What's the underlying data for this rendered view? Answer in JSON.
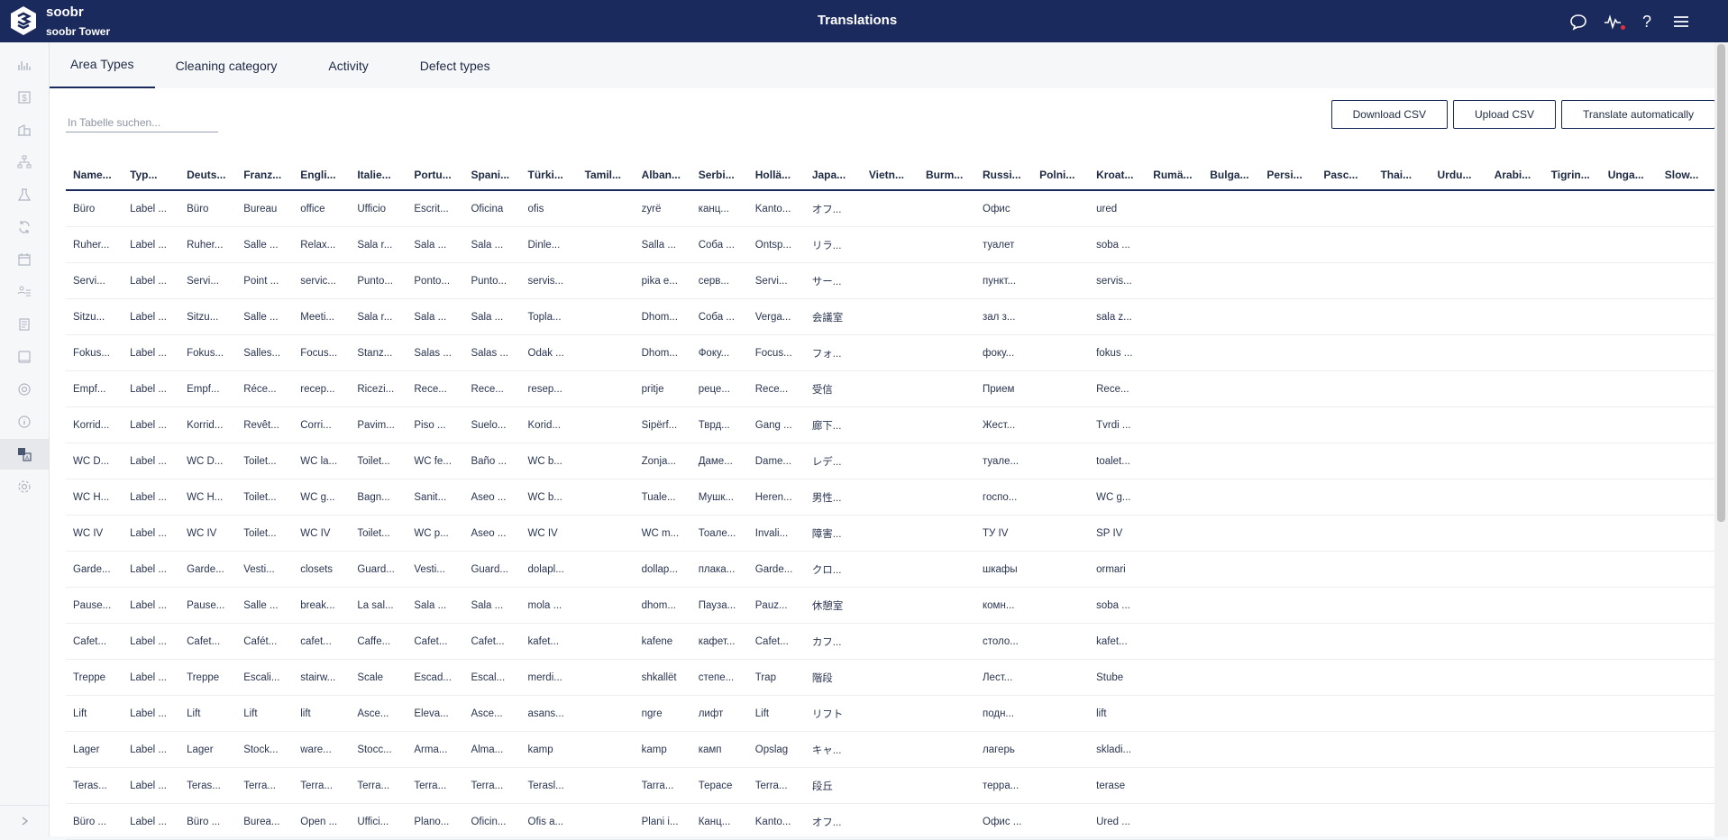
{
  "app": {
    "name": "soobr",
    "org": "soobr Tower",
    "title": "Translations"
  },
  "tabs": [
    {
      "label": "Area Types",
      "active": true
    },
    {
      "label": "Cleaning category",
      "active": false
    },
    {
      "label": "Activity",
      "active": false
    },
    {
      "label": "Defect types",
      "active": false
    }
  ],
  "search": {
    "placeholder": "In Tabelle suchen..."
  },
  "buttons": {
    "download": "Download CSV",
    "upload": "Upload CSV",
    "translate": "Translate automatically"
  },
  "table": {
    "columns": [
      "Name...",
      "Typ...",
      "Deuts...",
      "Franz...",
      "Engli...",
      "Italie...",
      "Portu...",
      "Spani...",
      "Türki...",
      "Tamil...",
      "Alban...",
      "Serbi...",
      "Hollä...",
      "Japa...",
      "Vietn...",
      "Burm...",
      "Russi...",
      "Polni...",
      "Kroat...",
      "Rumä...",
      "Bulga...",
      "Persi...",
      "Pasc...",
      "Thai...",
      "Urdu...",
      "Arabi...",
      "Tigrin...",
      "Unga...",
      "Slow..."
    ],
    "rows": [
      [
        "Büro",
        "Label ...",
        "Büro",
        "Bureau",
        "office",
        "Ufficio",
        "Escrit...",
        "Oficina",
        "ofis",
        "",
        "zyrë",
        "канц...",
        "Kanto...",
        "オフ...",
        "",
        "",
        "Офис",
        "",
        "ured",
        "",
        "",
        "",
        "",
        "",
        "",
        "",
        "",
        "",
        ""
      ],
      [
        "Ruher...",
        "Label ...",
        "Ruher...",
        "Salle ...",
        "Relax...",
        "Sala r...",
        "Sala ...",
        "Sala ...",
        "Dinle...",
        "",
        "Salla ...",
        "Соба ...",
        "Ontsp...",
        "リラ...",
        "",
        "",
        "туалет",
        "",
        "soba ...",
        "",
        "",
        "",
        "",
        "",
        "",
        "",
        "",
        "",
        ""
      ],
      [
        "Servi...",
        "Label ...",
        "Servi...",
        "Point ...",
        "servic...",
        "Punto...",
        "Ponto...",
        "Punto...",
        "servis...",
        "",
        "pika e...",
        "серв...",
        "Servi...",
        "サー...",
        "",
        "",
        "пункт...",
        "",
        "servis...",
        "",
        "",
        "",
        "",
        "",
        "",
        "",
        "",
        "",
        ""
      ],
      [
        "Sitzu...",
        "Label ...",
        "Sitzu...",
        "Salle ...",
        "Meeti...",
        "Sala r...",
        "Sala ...",
        "Sala ...",
        "Topla...",
        "",
        "Dhom...",
        "Соба ...",
        "Verga...",
        "会議室",
        "",
        "",
        "зал з...",
        "",
        "sala z...",
        "",
        "",
        "",
        "",
        "",
        "",
        "",
        "",
        "",
        ""
      ],
      [
        "Fokus...",
        "Label ...",
        "Fokus...",
        "Salles...",
        "Focus...",
        "Stanz...",
        "Salas ...",
        "Salas ...",
        "Odak ...",
        "",
        "Dhom...",
        "Фоку...",
        "Focus...",
        "フォ...",
        "",
        "",
        "фоку...",
        "",
        "fokus ...",
        "",
        "",
        "",
        "",
        "",
        "",
        "",
        "",
        "",
        ""
      ],
      [
        "Empf...",
        "Label ...",
        "Empf...",
        "Réce...",
        "recep...",
        "Ricezi...",
        "Rece...",
        "Rece...",
        "resep...",
        "",
        "pritje",
        "реце...",
        "Rece...",
        "受信",
        "",
        "",
        "Прием",
        "",
        "Rece...",
        "",
        "",
        "",
        "",
        "",
        "",
        "",
        "",
        "",
        ""
      ],
      [
        "Korrid...",
        "Label ...",
        "Korrid...",
        "Revêt...",
        "Corri...",
        "Pavim...",
        "Piso ...",
        "Suelo...",
        "Korid...",
        "",
        "Sipërf...",
        "Тврд...",
        "Gang ...",
        "廊下...",
        "",
        "",
        "Жест...",
        "",
        "Tvrdi ...",
        "",
        "",
        "",
        "",
        "",
        "",
        "",
        "",
        "",
        ""
      ],
      [
        "WC D...",
        "Label ...",
        "WC D...",
        "Toilet...",
        "WC la...",
        "Toilet...",
        "WC fe...",
        "Baño ...",
        "WC b...",
        "",
        "Zonja...",
        "Даме...",
        "Dame...",
        "レデ...",
        "",
        "",
        "туале...",
        "",
        "toalet...",
        "",
        "",
        "",
        "",
        "",
        "",
        "",
        "",
        "",
        ""
      ],
      [
        "WC H...",
        "Label ...",
        "WC H...",
        "Toilet...",
        "WC g...",
        "Bagn...",
        "Sanit...",
        "Aseo ...",
        "WC b...",
        "",
        "Tuale...",
        "Мушк...",
        "Heren...",
        "男性...",
        "",
        "",
        "госпо...",
        "",
        "WC g...",
        "",
        "",
        "",
        "",
        "",
        "",
        "",
        "",
        "",
        ""
      ],
      [
        "WC IV",
        "Label ...",
        "WC IV",
        "Toilet...",
        "WC IV",
        "Toilet...",
        "WC p...",
        "Aseo ...",
        "WC IV",
        "",
        "WC m...",
        "Тоале...",
        "Invali...",
        "障害...",
        "",
        "",
        "ТУ IV",
        "",
        "SP IV",
        "",
        "",
        "",
        "",
        "",
        "",
        "",
        "",
        "",
        ""
      ],
      [
        "Garde...",
        "Label ...",
        "Garde...",
        "Vesti...",
        "closets",
        "Guard...",
        "Vesti...",
        "Guard...",
        "dolapl...",
        "",
        "dollap...",
        "плака...",
        "Garde...",
        "クロ...",
        "",
        "",
        "шкафы",
        "",
        "ormari",
        "",
        "",
        "",
        "",
        "",
        "",
        "",
        "",
        "",
        ""
      ],
      [
        "Pause...",
        "Label ...",
        "Pause...",
        "Salle ...",
        "break...",
        "La sal...",
        "Sala ...",
        "Sala ...",
        "mola ...",
        "",
        "dhom...",
        "Пауза...",
        "Pauz...",
        "休憩室",
        "",
        "",
        "комн...",
        "",
        "soba ...",
        "",
        "",
        "",
        "",
        "",
        "",
        "",
        "",
        "",
        ""
      ],
      [
        "Cafet...",
        "Label ...",
        "Cafet...",
        "Cafét...",
        "cafet...",
        "Caffe...",
        "Cafet...",
        "Cafet...",
        "kafet...",
        "",
        "kafene",
        "кафет...",
        "Cafet...",
        "カフ...",
        "",
        "",
        "столо...",
        "",
        "kafet...",
        "",
        "",
        "",
        "",
        "",
        "",
        "",
        "",
        "",
        ""
      ],
      [
        "Treppe",
        "Label ...",
        "Treppe",
        "Escali...",
        "stairw...",
        "Scale",
        "Escad...",
        "Escal...",
        "merdi...",
        "",
        "shkallët",
        "степе...",
        "Trap",
        "階段",
        "",
        "",
        "Лест...",
        "",
        "Stube",
        "",
        "",
        "",
        "",
        "",
        "",
        "",
        "",
        "",
        ""
      ],
      [
        "Lift",
        "Label ...",
        "Lift",
        "Lift",
        "lift",
        "Asce...",
        "Eleva...",
        "Asce...",
        "asans...",
        "",
        "ngre",
        "лифт",
        "Lift",
        "リフト",
        "",
        "",
        "подн...",
        "",
        "lift",
        "",
        "",
        "",
        "",
        "",
        "",
        "",
        "",
        "",
        ""
      ],
      [
        "Lager",
        "Label ...",
        "Lager",
        "Stock...",
        "ware...",
        "Stocc...",
        "Arma...",
        "Alma...",
        "kamp",
        "",
        "kamp",
        "камп",
        "Opslag",
        "キャ...",
        "",
        "",
        "лагерь",
        "",
        "skladi...",
        "",
        "",
        "",
        "",
        "",
        "",
        "",
        "",
        "",
        ""
      ],
      [
        "Teras...",
        "Label ...",
        "Teras...",
        "Terra...",
        "Terra...",
        "Terra...",
        "Terra...",
        "Terra...",
        "Terasl...",
        "",
        "Tarra...",
        "Терасе",
        "Terra...",
        "段丘",
        "",
        "",
        "терра...",
        "",
        "terase",
        "",
        "",
        "",
        "",
        "",
        "",
        "",
        "",
        "",
        ""
      ],
      [
        "Büro ...",
        "Label ...",
        "Büro ...",
        "Burea...",
        "Open ...",
        "Uffici...",
        "Plano...",
        "Oficin...",
        "Ofis a...",
        "",
        "Plani i...",
        "Канц...",
        "Kanto...",
        "オフ...",
        "",
        "",
        "Офис ...",
        "",
        "Ured ...",
        "",
        "",
        "",
        "",
        "",
        "",
        "",
        "",
        "",
        ""
      ]
    ]
  },
  "icons": {
    "sidebar": [
      "chart-icon",
      "dollar-icon",
      "building-icon",
      "hierarchy-icon",
      "flask-icon",
      "sync-icon",
      "calendar-icon",
      "assign-icon",
      "document-icon",
      "tablet-icon",
      "target-icon",
      "info-icon",
      "translate-icon",
      "settings-icon"
    ],
    "sidebar_active": "translate-icon",
    "top": [
      "chat-icon",
      "activity-icon",
      "help-icon",
      "menu-icon"
    ]
  },
  "colors": {
    "header": "#1b2a5c",
    "alert_dot": "#e0323c"
  }
}
